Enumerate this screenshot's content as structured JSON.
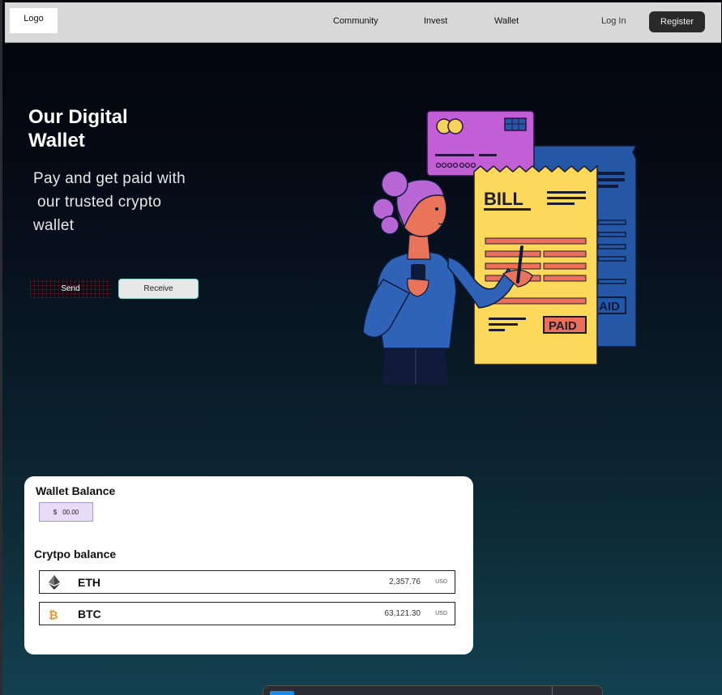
{
  "header": {
    "logo": "Logo",
    "nav": [
      "Community",
      "Invest",
      "Wallet"
    ],
    "login": "Log In",
    "register": "Register"
  },
  "hero": {
    "title_line1": "Our Digital",
    "title_line2": "Wallet",
    "subtitle_line1": "Pay and get paid with",
    "subtitle_line2": "our trusted crypto",
    "subtitle_line3": "wallet",
    "send": "Send",
    "receive": "Receive"
  },
  "illustration": {
    "bill_text": "BILL",
    "paid_text": "PAID",
    "paid_back_text": "AID"
  },
  "wallet": {
    "title": "Wallet Balance",
    "currency_symbol": "$",
    "amount": "00.00",
    "crypto_title": "Crytpo balance",
    "coins": [
      {
        "symbol": "ETH",
        "price": "2,357.76",
        "unit": "USD",
        "icon": "ethereum-icon"
      },
      {
        "symbol": "BTC",
        "price": "63,121.30",
        "unit": "USD",
        "icon": "bitcoin-icon"
      }
    ]
  },
  "colors": {
    "header_bg": "#d8d8d8",
    "register_bg": "#2a2a2a",
    "bill_yellow": "#fcd95a",
    "card_purple": "#c25ed6",
    "receipt_blue": "#2458a6",
    "person_blue": "#2f63b8",
    "skin": "#e9745a",
    "hair": "#b866d6",
    "line_red": "#ec6f5a",
    "btc_orange": "#f7931a"
  }
}
